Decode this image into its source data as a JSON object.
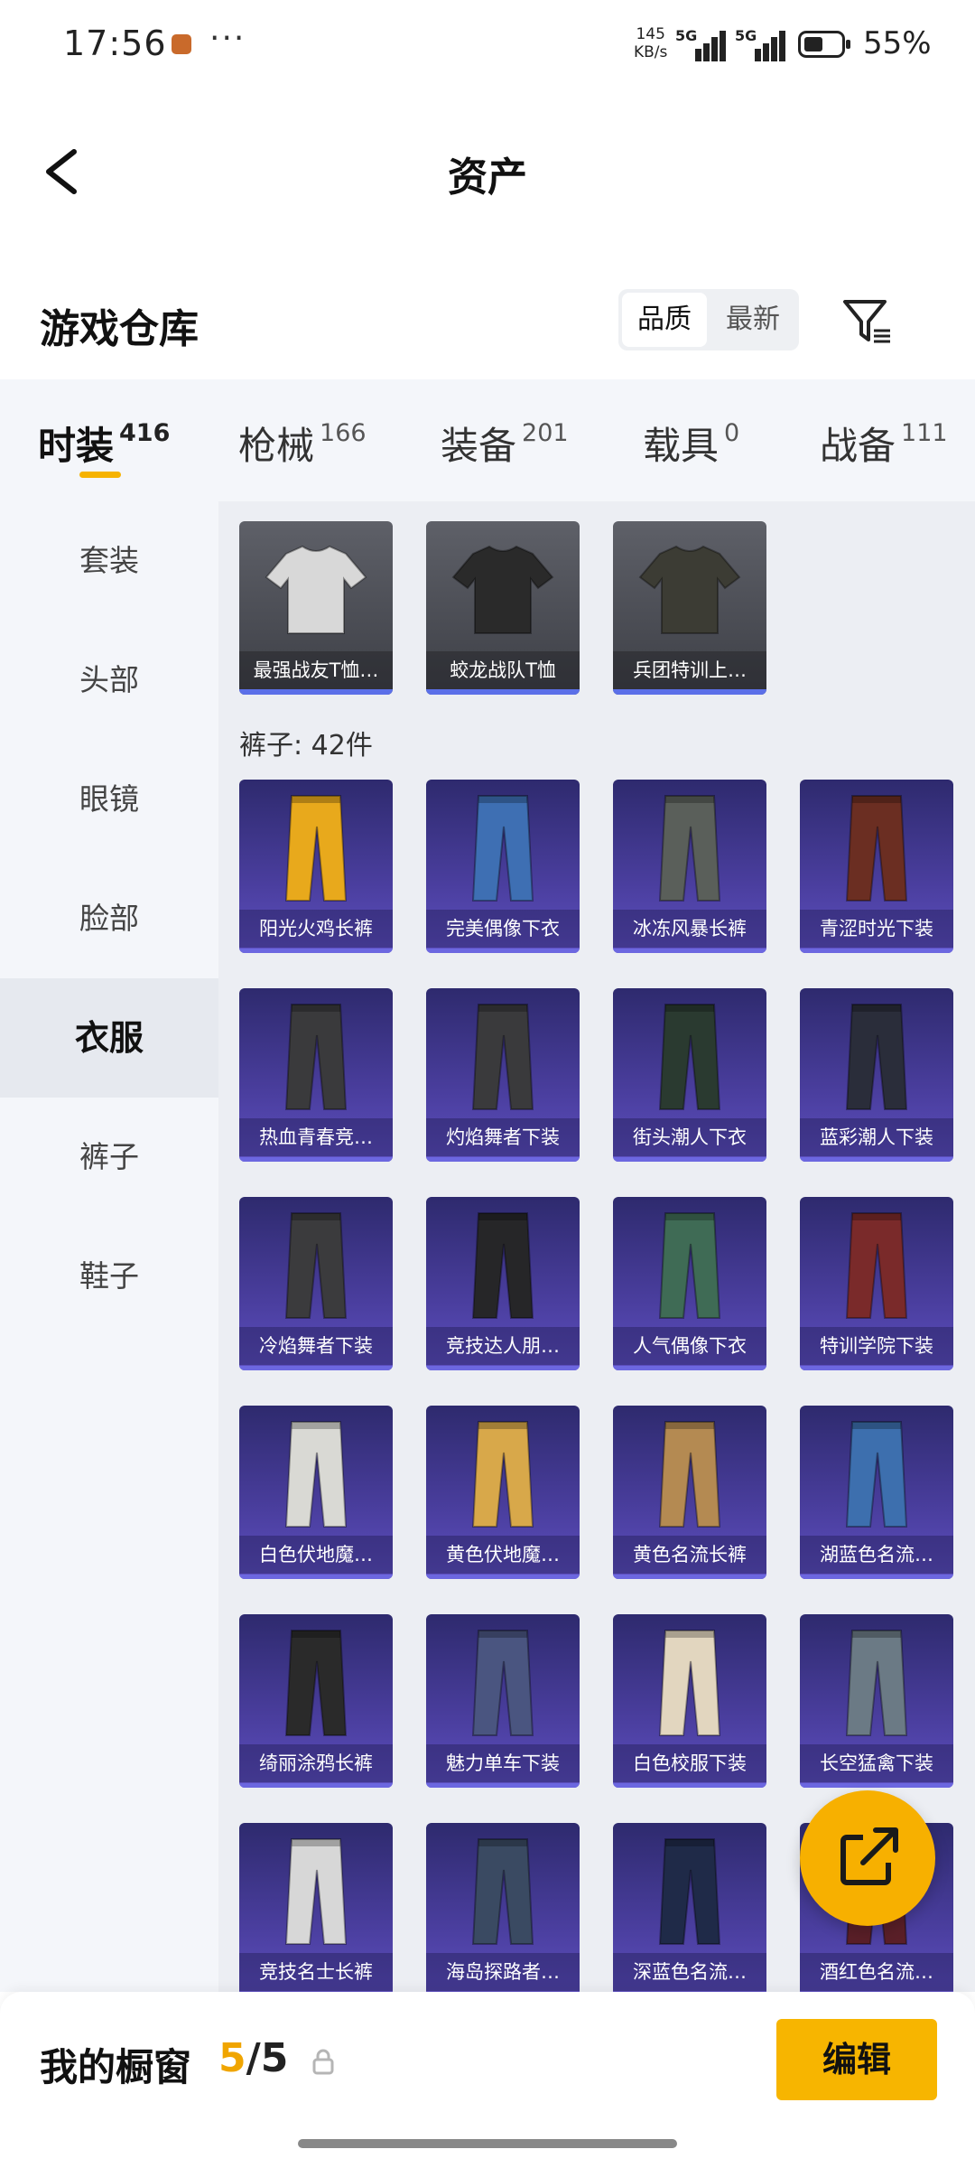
{
  "status_bar": {
    "time": "17:56",
    "net_speed_value": "145",
    "net_speed_unit": "KB/s",
    "signal_1": "5G",
    "signal_2": "5G",
    "battery": "55%",
    "battery_level": 0.55
  },
  "nav": {
    "title": "资产"
  },
  "section": {
    "title": "游戏仓库",
    "sort_options": [
      "品质",
      "最新"
    ],
    "sort_selected": "品质"
  },
  "tabs": [
    {
      "label": "时装",
      "count": "416"
    },
    {
      "label": "枪械",
      "count": "166"
    },
    {
      "label": "装备",
      "count": "201"
    },
    {
      "label": "载具",
      "count": "0"
    },
    {
      "label": "战备",
      "count": "111"
    }
  ],
  "active_tab": "时装",
  "sidebar": [
    "套装",
    "头部",
    "眼镜",
    "脸部",
    "衣服",
    "裤子",
    "鞋子"
  ],
  "active_sidebar": "衣服",
  "tops": [
    "最强战友T恤…",
    "蛟龙战队T恤",
    "兵团特训上…"
  ],
  "pants_header": "裤子: 42件",
  "pants": [
    "阳光火鸡长裤",
    "完美偶像下衣",
    "冰冻风暴长裤",
    "青涩时光下装",
    "热血青春竞…",
    "灼焰舞者下装",
    "街头潮人下衣",
    "蓝彩潮人下装",
    "冷焰舞者下装",
    "竞技达人朋…",
    "人气偶像下衣",
    "特训学院下装",
    "白色伏地魔…",
    "黄色伏地魔…",
    "黄色名流长裤",
    "湖蓝色名流…",
    "绮丽涂鸦长裤",
    "魅力单车下装",
    "白色校服下装",
    "长空猛禽下装",
    "竞技名士长裤",
    "海岛探路者…",
    "深蓝色名流…",
    "酒红色名流…"
  ],
  "pants_colors": [
    "#e8a91c",
    "#3e6fb3",
    "#5a5f5a",
    "#6b2e22",
    "#3a3a3c",
    "#3a3a3c",
    "#2a3a30",
    "#2a2d3a",
    "#3b3b3d",
    "#262628",
    "#3f6b55",
    "#7a2a2a",
    "#d9d9d4",
    "#d8a84a",
    "#b48a52",
    "#3d6fae",
    "#2a2a2a",
    "#4a5580",
    "#e2d6bf",
    "#6b7a85",
    "#d7d7d7",
    "#3a4a62",
    "#1f2a48",
    "#5a1f28"
  ],
  "tops_colors": [
    "#d8d8d8",
    "#2a2a2a",
    "#3c3c34"
  ],
  "bottom": {
    "label": "我的橱窗",
    "current": "5",
    "total": "/5",
    "edit": "编辑"
  }
}
